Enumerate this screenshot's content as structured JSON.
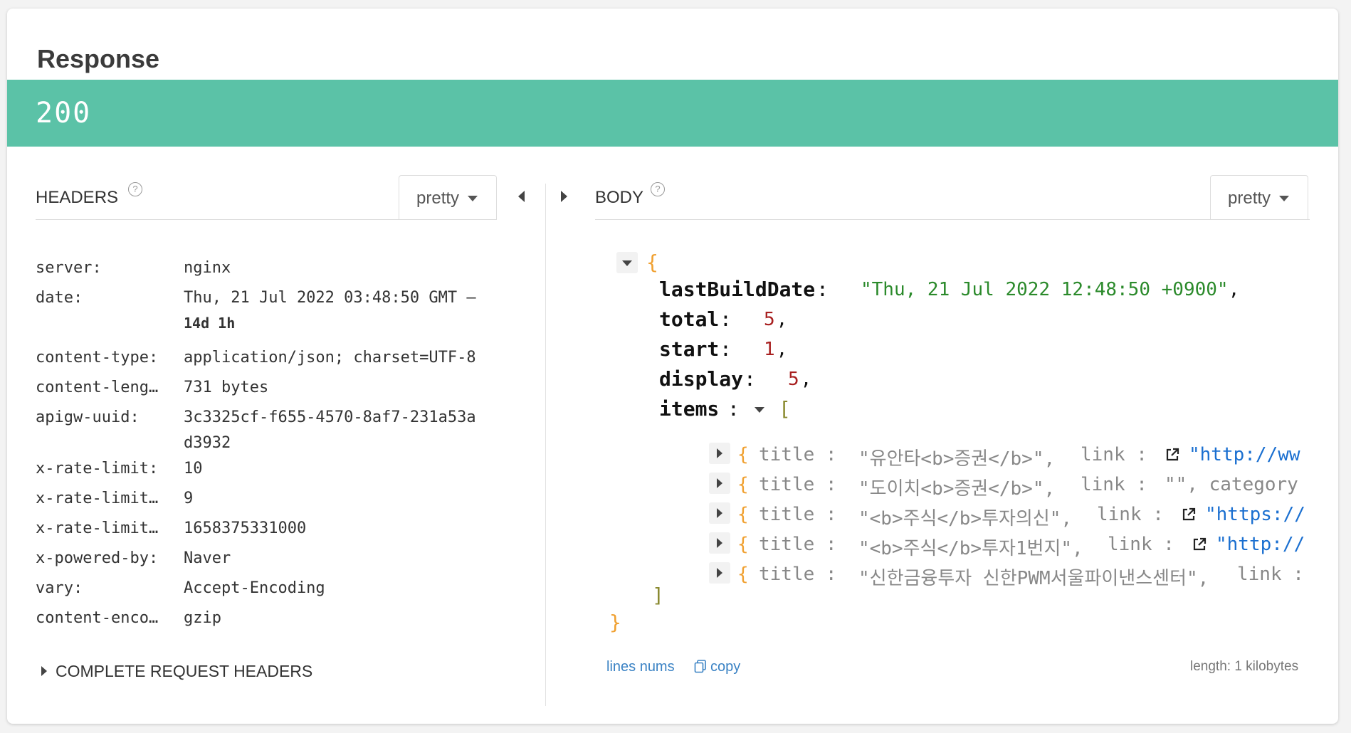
{
  "response": {
    "title": "Response",
    "status_code": "200",
    "status_color": "#5bc2a7"
  },
  "headers_panel": {
    "label": "HEADERS",
    "help": "?",
    "format": "pretty",
    "rows": [
      {
        "key": "server:",
        "value": "nginx"
      },
      {
        "key": "date:",
        "value": "Thu, 21 Jul 2022 03:48:50 GMT –",
        "value2": "14d 1h"
      },
      {
        "key": "content-type:",
        "value": "application/json; charset=UTF-8"
      },
      {
        "key": "content-leng…",
        "value": "731 bytes"
      },
      {
        "key": "apigw-uuid:",
        "value": "3c3325cf-f655-4570-8af7-231a53a",
        "value2": "d3932"
      },
      {
        "key": "x-rate-limit:",
        "value": "10"
      },
      {
        "key": "x-rate-limit…",
        "value": "9"
      },
      {
        "key": "x-rate-limit…",
        "value": "1658375331000"
      },
      {
        "key": "x-powered-by:",
        "value": "Naver"
      },
      {
        "key": "vary:",
        "value": "Accept-Encoding"
      },
      {
        "key": "content-enco…",
        "value": "gzip"
      }
    ],
    "complete_request_headers": "COMPLETE REQUEST HEADERS"
  },
  "body_panel": {
    "label": "BODY",
    "help": "?",
    "format": "pretty",
    "open_brace": "{",
    "close_brace": "}",
    "fields": [
      {
        "key": "lastBuildDate",
        "sep": " : ",
        "value": "\"Thu, 21 Jul 2022 12:48:50 +0900\"",
        "type": "string"
      },
      {
        "key": "total",
        "sep": " : ",
        "value": "5",
        "type": "number"
      },
      {
        "key": "start",
        "sep": " : ",
        "value": "1",
        "type": "number"
      },
      {
        "key": "display",
        "sep": " : ",
        "value": "5",
        "type": "number"
      }
    ],
    "items_key": "items",
    "items_open": "[",
    "items_close": "]",
    "items": [
      {
        "title": "\"유안타<b>증권</b>\",",
        "link_label": "link :",
        "link_value": "\"http://ww",
        "has_link_icon": true
      },
      {
        "title": "\"도이치<b>증권</b>\",",
        "link_label": "link :",
        "link_value": "\"\",  category",
        "has_link_icon": false
      },
      {
        "title": "\"<b>주식</b>투자의신\",",
        "link_label": "link :",
        "link_value": "\"https://",
        "has_link_icon": true
      },
      {
        "title": "\"<b>주식</b>투자1번지\",",
        "link_label": "link :",
        "link_value": "\"http://",
        "has_link_icon": true
      },
      {
        "title": "\"신한금융투자 신한PWM서울파이낸스센터\",",
        "link_label": "link :",
        "link_value": "",
        "has_link_icon": false
      }
    ],
    "item_open": "{",
    "item_title_label": "title :",
    "footer": {
      "line_nums": "lines nums",
      "copy": "copy",
      "length": "length: 1 kilobytes"
    }
  }
}
